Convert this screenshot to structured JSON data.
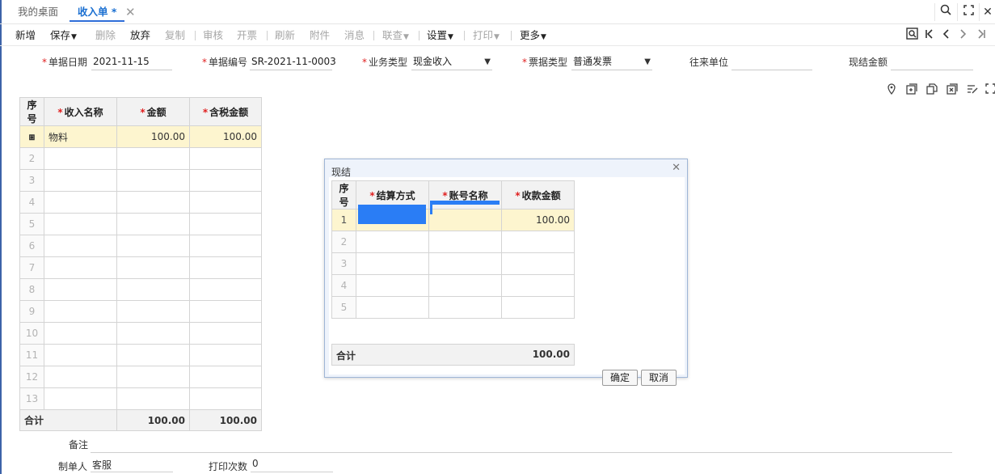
{
  "tabs": {
    "desktop": "我的桌面",
    "income": "收入单 *"
  },
  "toolbar": {
    "add": "新增",
    "save": "保存",
    "delete": "删除",
    "discard": "放弃",
    "copy": "复制",
    "audit": "审核",
    "invoice": "开票",
    "refresh": "刷新",
    "attachment": "附件",
    "message": "消息",
    "linked_query": "联查",
    "settings": "设置",
    "print": "打印",
    "more": "更多"
  },
  "form": {
    "date_label": "单据日期",
    "date_value": "2021-11-15",
    "number_label": "单据编号",
    "number_value": "SR-2021-11-0003",
    "biz_type_label": "业务类型",
    "biz_type_value": "现金收入",
    "invoice_type_label": "票据类型",
    "invoice_type_value": "普通发票",
    "partner_label": "往来单位",
    "partner_value": "",
    "cash_amount_label": "现结金额",
    "cash_amount_value": ""
  },
  "grid": {
    "headers": [
      "序号",
      "收入名称",
      "金额",
      "含税金额"
    ],
    "rows": [
      {
        "idx": "",
        "name": "物料",
        "amount": "100.00",
        "tax_amount": "100.00"
      },
      {
        "idx": "2"
      },
      {
        "idx": "3"
      },
      {
        "idx": "4"
      },
      {
        "idx": "5"
      },
      {
        "idx": "6"
      },
      {
        "idx": "7"
      },
      {
        "idx": "8"
      },
      {
        "idx": "9"
      },
      {
        "idx": "10"
      },
      {
        "idx": "11"
      },
      {
        "idx": "12"
      },
      {
        "idx": "13"
      }
    ],
    "total_label": "合计",
    "total_amount": "100.00",
    "total_tax_amount": "100.00"
  },
  "footer": {
    "remark_label": "备注",
    "maker_label": "制单人",
    "maker_value": "客服",
    "print_count_label": "打印次数",
    "print_count_value": "0"
  },
  "dialog": {
    "title": "现结",
    "headers": [
      "序号",
      "结算方式",
      "账号名称",
      "收款金额"
    ],
    "rows": [
      {
        "idx": "1",
        "amount": "100.00"
      },
      {
        "idx": "2"
      },
      {
        "idx": "3"
      },
      {
        "idx": "4"
      },
      {
        "idx": "5"
      }
    ],
    "total_label": "合计",
    "total_amount": "100.00",
    "ok": "确定",
    "cancel": "取消"
  }
}
